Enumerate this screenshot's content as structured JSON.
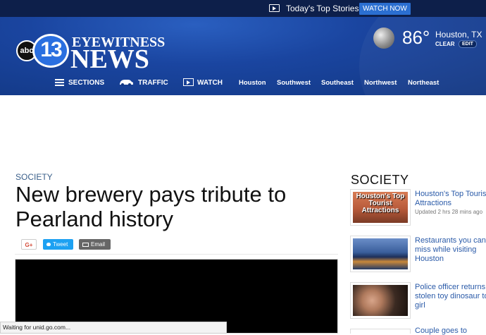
{
  "topbar": {
    "stories_label": "Today's Top Stories",
    "watch_now_label": "WATCH NOW"
  },
  "logo": {
    "abc": "abc",
    "number": "13",
    "eyewitness": "EYEWITNESS",
    "news": "NEWS"
  },
  "weather": {
    "temp": "86°",
    "city": "Houston, TX",
    "condition": "CLEAR",
    "edit_label": "EDIT",
    "icon": "moon-icon"
  },
  "nav": {
    "sections": "SECTIONS",
    "traffic": "TRAFFIC",
    "watch": "WATCH",
    "regions": [
      "Houston",
      "Southwest",
      "Southeast",
      "Northwest",
      "Northeast"
    ]
  },
  "article": {
    "kicker": "SOCIETY",
    "headline": "New brewery pays tribute to Pearland history",
    "share": {
      "gplus": "G+",
      "tweet": "Tweet",
      "email": "Email"
    }
  },
  "sidebar": {
    "title": "SOCIETY",
    "items": [
      {
        "title": "Houston's Top Tourist Attractions",
        "updated": "Updated 2 hrs 28 mins ago",
        "thumb_text": "Houston's Top Tourist Attractions"
      },
      {
        "title": "Restaurants you can't miss while visiting Houston"
      },
      {
        "title": "Police officer returns stolen toy dinosaur to girl"
      },
      {
        "title": "Couple goes to"
      }
    ]
  },
  "status_bar": {
    "text": "Waiting for unid.go.com..."
  },
  "colors": {
    "header_blue": "#1a45a0",
    "topbar_navy": "#0d1f4a",
    "link_blue": "#2a5aa8",
    "watch_now": "#2b6fd1"
  }
}
